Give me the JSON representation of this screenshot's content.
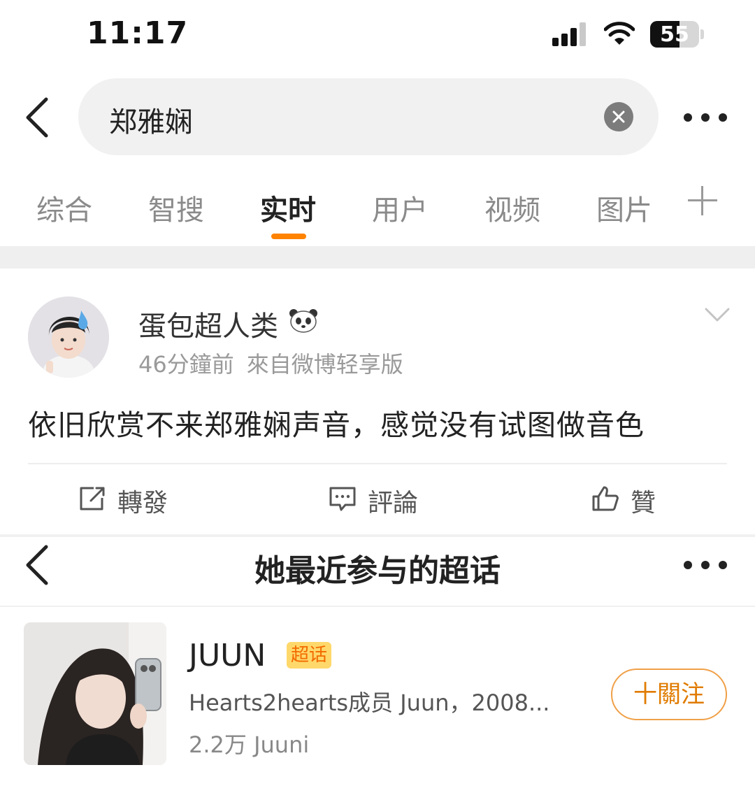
{
  "status_bar": {
    "time": "11:17",
    "battery": "55",
    "icons": [
      "signal-icon",
      "wifi-icon",
      "battery-icon"
    ]
  },
  "search": {
    "query": "郑雅娴",
    "icons": [
      "back-chevron-icon",
      "clear-icon",
      "more-icon"
    ]
  },
  "tabs": [
    {
      "label": "综合",
      "active": false
    },
    {
      "label": "智搜",
      "active": false
    },
    {
      "label": "实时",
      "active": true
    },
    {
      "label": "用户",
      "active": false
    },
    {
      "label": "视频",
      "active": false
    },
    {
      "label": "图片",
      "active": false
    }
  ],
  "post": {
    "user_name": "蛋包超人类",
    "time_ago": "46分鐘前",
    "source": "來自微博轻享版",
    "text": "依旧欣赏不来郑雅娴声音，感觉没有试图做音色",
    "actions": {
      "repost": "轉發",
      "comment": "評論",
      "like": "贊"
    }
  },
  "supertopic_section": {
    "title": "她最近参与的超话",
    "topic": {
      "name": "JUUN",
      "badge": "超话",
      "description": "Hearts2hearts成员 Juun，2008...",
      "followers": "2.2万 Juuni",
      "follow_label": "十關注"
    }
  },
  "colors": {
    "accent": "#ff8200",
    "badge_bg": "#ffd86b",
    "follow_border": "#f0a048",
    "muted": "#9a9a9a"
  }
}
